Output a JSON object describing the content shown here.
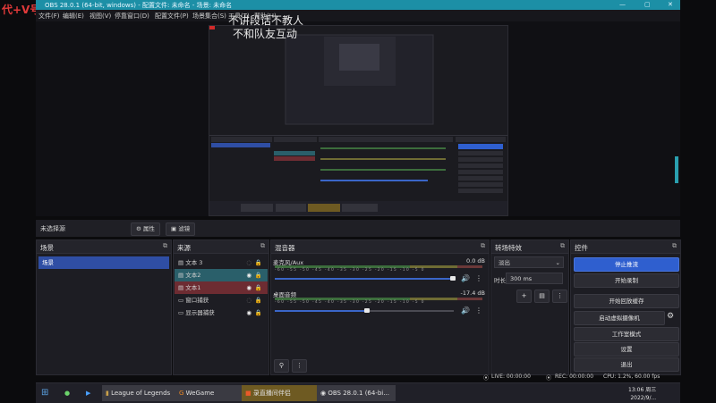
{
  "watermark": "代+V号码",
  "titlebar": {
    "title": "OBS 28.0.1 (64-bit, windows) - 配置文件: 未命名 - 场景: 未命名",
    "min": "—",
    "max": "▢",
    "close": "✕"
  },
  "menu": [
    "文件(F)",
    "编辑(E)",
    "视图(V)",
    "停靠窗口(D)",
    "配置文件(P)",
    "场景集合(S)",
    "工具(T)",
    "帮助(H)"
  ],
  "overlay_text": {
    "line1": "不讲段话不教人",
    "line2": "不和队友互动"
  },
  "statusrow": {
    "label": "未选择源",
    "properties": "属性",
    "filters": "滤镜"
  },
  "scenes": {
    "title": "场景",
    "items": [
      "场景"
    ]
  },
  "sources": {
    "title": "来源",
    "items": [
      {
        "label": "文本 3"
      },
      {
        "label": "文本2"
      },
      {
        "label": "文本1"
      },
      {
        "label": "窗口捕获"
      },
      {
        "label": "显示器捕获"
      }
    ]
  },
  "mixer": {
    "title": "混音器",
    "ticks": "-60 -55 -50 -45 -40 -35 -30 -25 -20 -15 -10 -5 0",
    "channels": [
      {
        "name": "麦克风/Aux",
        "db": "0.0 dB",
        "level": 0.0
      },
      {
        "name": "桌面音频",
        "db": "-17.4 dB",
        "level": 0.55
      }
    ]
  },
  "transitions": {
    "title": "转场特效",
    "selected": "淡出",
    "duration_label": "时长",
    "duration_value": "300 ms"
  },
  "controls": {
    "title": "控件",
    "buttons": [
      "停止推流",
      "开始录制",
      "开始回放缓存",
      "启动虚拟摄像机",
      "工作室模式",
      "设置",
      "退出"
    ]
  },
  "status": {
    "live": "LIVE: 00:00:00",
    "rec": "REC: 00:00:00",
    "cpu": "CPU: 1.2%, 60.00 fps"
  },
  "taskbar": {
    "items": [
      "League of Legends",
      "WeGame",
      "录直播间伴侣",
      "OBS 28.0.1 (64-bi..."
    ],
    "time": "13:06 周三",
    "date": "2022/9/..."
  },
  "colors": {
    "accent": "#2f5fcf",
    "titlebar": "#1c8fa6"
  }
}
